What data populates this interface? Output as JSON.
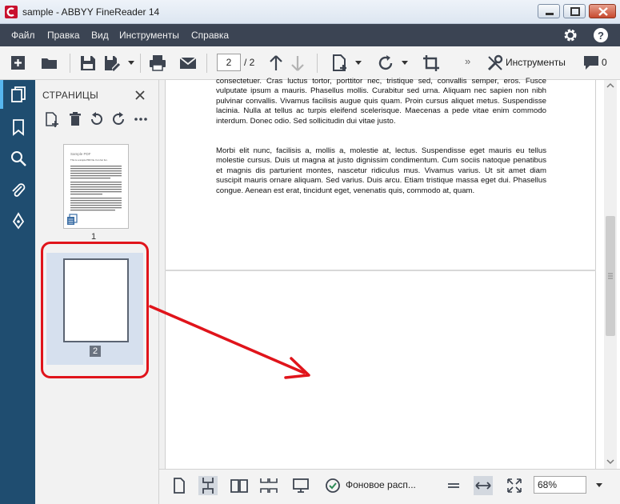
{
  "window": {
    "title": "sample - ABBYY FineReader 14"
  },
  "menu": {
    "items": [
      "Файл",
      "Правка",
      "Вид",
      "Инструменты",
      "Справка"
    ]
  },
  "toolbar": {
    "page_current": "2",
    "page_total": "/ 2",
    "tools_label": "Инструменты",
    "comments_count": "0",
    "more": "»"
  },
  "pages_panel": {
    "title": "СТРАНИЦЫ",
    "thumbnails": [
      {
        "number": "1",
        "mini_title": "Sample PDF",
        "mini_subtitle": "This is a simple PDF file. Fun fun fun."
      },
      {
        "number": "2"
      }
    ]
  },
  "document": {
    "paragraphs": [
      "consectetuer. Cras luctus tortor, porttitor nec, tristique sed, convallis semper, eros. Fusce vulputate ipsum a mauris. Phasellus mollis. Curabitur sed urna. Aliquam nec sapien non nibh pulvinar convallis. Vivamus facilisis augue quis quam. Proin cursus aliquet metus. Suspendisse lacinia. Nulla at tellus ac turpis eleifend scelerisque. Maecenas a pede vitae enim commodo interdum. Donec odio. Sed sollicitudin dui vitae justo.",
      "Morbi elit nunc, facilisis a, mollis a, molestie at, lectus. Suspendisse eget mauris eu tellus molestie cursus. Duis ut magna at justo dignissim condimentum. Cum sociis natoque penatibus et magnis dis parturient montes, nascetur ridiculus mus. Vivamus varius. Ut sit amet diam suscipit mauris ornare aliquam. Sed varius. Duis arcu. Etiam tristique massa eget dui. Phasellus congue. Aenean est erat, tincidunt eget, venenatis quis, commodo at, quam."
    ]
  },
  "statusbar": {
    "background_label": "Фоновое расп...",
    "zoom": "68%"
  },
  "colors": {
    "menubar": "#3b4453",
    "iconrail": "#1f4d70",
    "highlight": "#e0141b",
    "accent": "#57b6ef"
  }
}
